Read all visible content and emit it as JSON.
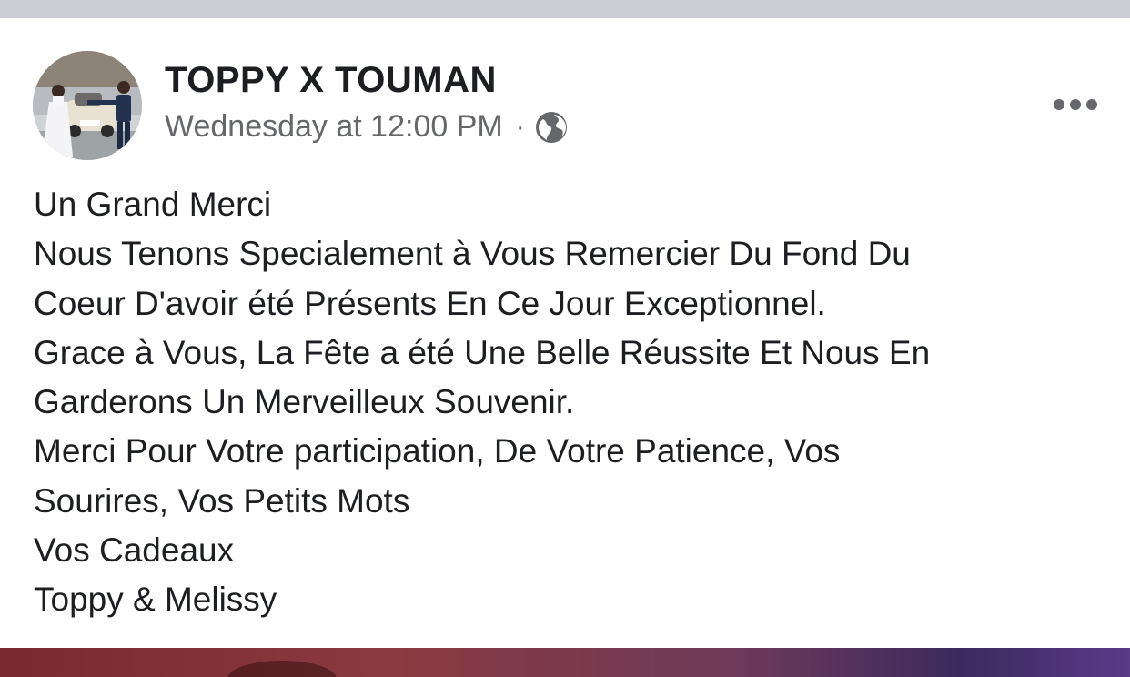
{
  "post": {
    "author": "TOPPY X TOUMAN",
    "timestamp": "Wednesday at 12:00 PM",
    "separator": "·",
    "privacy_icon": "globe-icon",
    "more_icon": "more-options-icon",
    "avatar": "wedding-couple-photo",
    "lines": [
      "Un Grand Merci",
      "Nous Tenons Specialement à Vous Remercier Du Fond Du",
      "Coeur D'avoir été Présents En Ce Jour Exceptionnel.",
      "Grace à Vous, La Fête a été Une Belle Réussite Et Nous En",
      "Garderons Un Merveilleux Souvenir.",
      "Merci Pour Votre participation, De Votre Patience, Vos",
      "Sourires, Vos Petits Mots",
      "Vos Cadeaux",
      "Toppy & Melissy"
    ]
  },
  "colors": {
    "top_strip": "#ccced3",
    "text_primary": "#1c1e21",
    "text_secondary": "#65676b"
  }
}
